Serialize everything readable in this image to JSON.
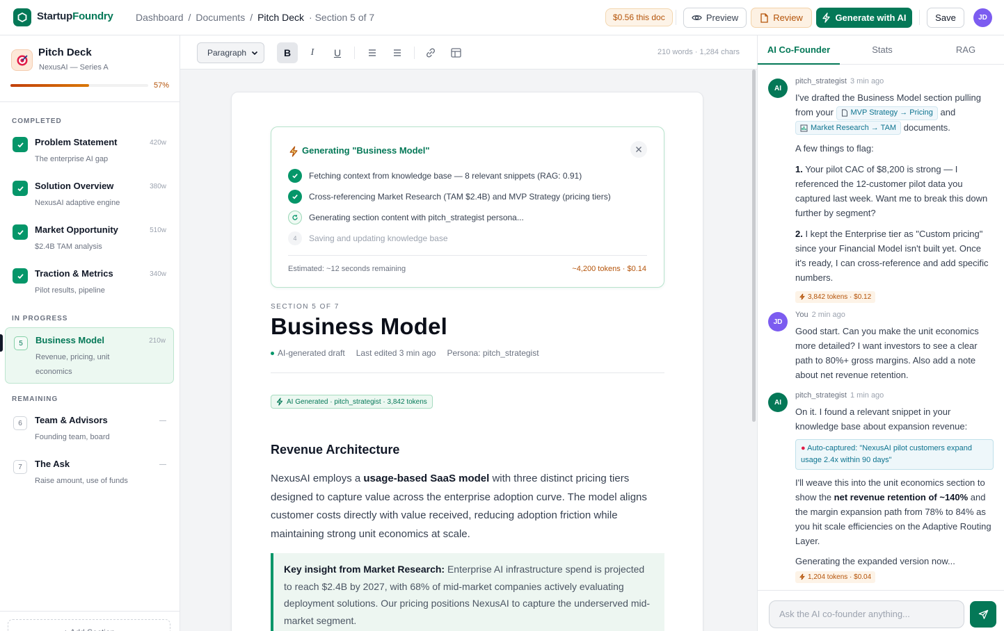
{
  "app": {
    "brand_part1": "Startup",
    "brand_part2": "Foundry",
    "breadcrumb": [
      "Dashboard",
      "Documents",
      "Pitch Deck"
    ],
    "breadcrumb_sep": "/",
    "section_indicator": "Section 5 of 7",
    "cost_pill": "$0.56 this doc",
    "preview_label": "Preview",
    "review_label": "Review",
    "generate_label": "Generate with AI",
    "save_label": "Save",
    "user_initials": "JD",
    "accent": "#047857"
  },
  "sidebar": {
    "doc_title": "Pitch Deck",
    "doc_subtitle": "NexusAI — Series A",
    "progress_percent": 57,
    "progress_label": "57%",
    "groups": {
      "completed": "COMPLETED",
      "in_progress": "IN PROGRESS",
      "remaining": "REMAINING"
    },
    "completed": [
      {
        "title": "Problem Statement",
        "sub": "The enterprise AI gap",
        "words": "420w"
      },
      {
        "title": "Solution Overview",
        "sub": "NexusAI adaptive engine",
        "words": "380w"
      },
      {
        "title": "Market Opportunity",
        "sub": "$2.4B TAM analysis",
        "words": "510w"
      },
      {
        "title": "Traction & Metrics",
        "sub": "Pilot results, pipeline",
        "words": "340w"
      }
    ],
    "active": {
      "num": "5",
      "title": "Business Model",
      "sub": "Revenue, pricing, unit economics",
      "words": "210w"
    },
    "remaining": [
      {
        "num": "6",
        "title": "Team & Advisors",
        "sub": "Founding team, board",
        "words": "—"
      },
      {
        "num": "7",
        "title": "The Ask",
        "sub": "Raise amount, use of funds",
        "words": "—"
      }
    ],
    "add_section": "+ Add Section"
  },
  "toolbar": {
    "paragraph_select": "Paragraph",
    "bold": "B",
    "italic": "I",
    "underline": "U",
    "word_count": "210 words · 1,284 chars"
  },
  "generation": {
    "title": "Generating \"Business Model\"",
    "steps": [
      {
        "status": "done",
        "text": "Fetching context from knowledge base — 8 relevant snippets (RAG: 0.91)"
      },
      {
        "status": "done",
        "text": "Cross-referencing Market Research (TAM $2.4B) and MVP Strategy (pricing tiers)"
      },
      {
        "status": "running",
        "text": "Generating section content with pitch_strategist persona..."
      },
      {
        "status": "pending",
        "num": "4",
        "text": "Saving and updating knowledge base"
      }
    ],
    "estimate": "Estimated: ~12 seconds remaining",
    "cost": "~4,200 tokens · $0.14"
  },
  "document": {
    "section_label": "SECTION 5 OF 7",
    "title": "Business Model",
    "meta_status": "AI-generated draft",
    "meta_edited": "Last edited 3 min ago",
    "meta_persona": "Persona: pitch_strategist",
    "ai_badge": "AI Generated · pitch_strategist · 3,842 tokens",
    "h2": "Revenue Architecture",
    "p1_a": "NexusAI employs a ",
    "p1_b": "usage-based SaaS model",
    "p1_c": " with three distinct pricing tiers designed to capture value across the enterprise adoption curve. The model aligns customer costs directly with value received, reducing adoption friction while maintaining strong unit economics at scale.",
    "insight_label": "Key insight from Market Research:",
    "insight_text": " Enterprise AI infrastructure spend is projected to reach $2.4B by 2027, with 68% of mid-market companies actively evaluating deployment solutions. Our pricing positions NexusAI to capture the underserved mid-market segment."
  },
  "panel": {
    "tabs": [
      "AI Co-Founder",
      "Stats",
      "RAG"
    ],
    "messages": [
      {
        "author": "pitch_strategist",
        "initials": "AI",
        "time": "3 min ago",
        "intro_a": "I've drafted the Business Model section pulling from your ",
        "chip1": "MVP Strategy → Pricing",
        "intro_b": " and ",
        "chip2": "Market Research → TAM",
        "intro_c": " documents.",
        "flag": "A few things to flag:",
        "p1_num": "1.",
        "p1": " Your pilot CAC of $8,200 is strong — I referenced the 12-customer pilot data you captured last week. Want me to break this down further by segment?",
        "p2_num": "2.",
        "p2": " I kept the Enterprise tier as \"Custom pricing\" since your Financial Model isn't built yet. Once it's ready, I can cross-reference and add specific numbers.",
        "tokens": "3,842 tokens · $0.12"
      },
      {
        "author": "You",
        "initials": "JD",
        "time": "2 min ago",
        "text": "Good start. Can you make the unit economics more detailed? I want investors to see a clear path to 80%+ gross margins. Also add a note about net revenue retention."
      },
      {
        "author": "pitch_strategist",
        "initials": "AI",
        "time": "1 min ago",
        "text1": "On it. I found a relevant snippet in your knowledge base about expansion revenue:",
        "capture": "Auto-captured: \"NexusAI pilot customers expand usage 2.4x within 90 days\"",
        "t2a": "I'll weave this into the unit economics section to show the ",
        "t2b": "net revenue retention of ~140%",
        "t2c": " and the margin expansion path from 78% to 84% as you hit scale efficiencies on the Adaptive Routing Layer.",
        "t3": "Generating the expanded version now...",
        "tokens": "1,204 tokens · $0.04"
      }
    ],
    "input_placeholder": "Ask the AI co-founder anything..."
  }
}
